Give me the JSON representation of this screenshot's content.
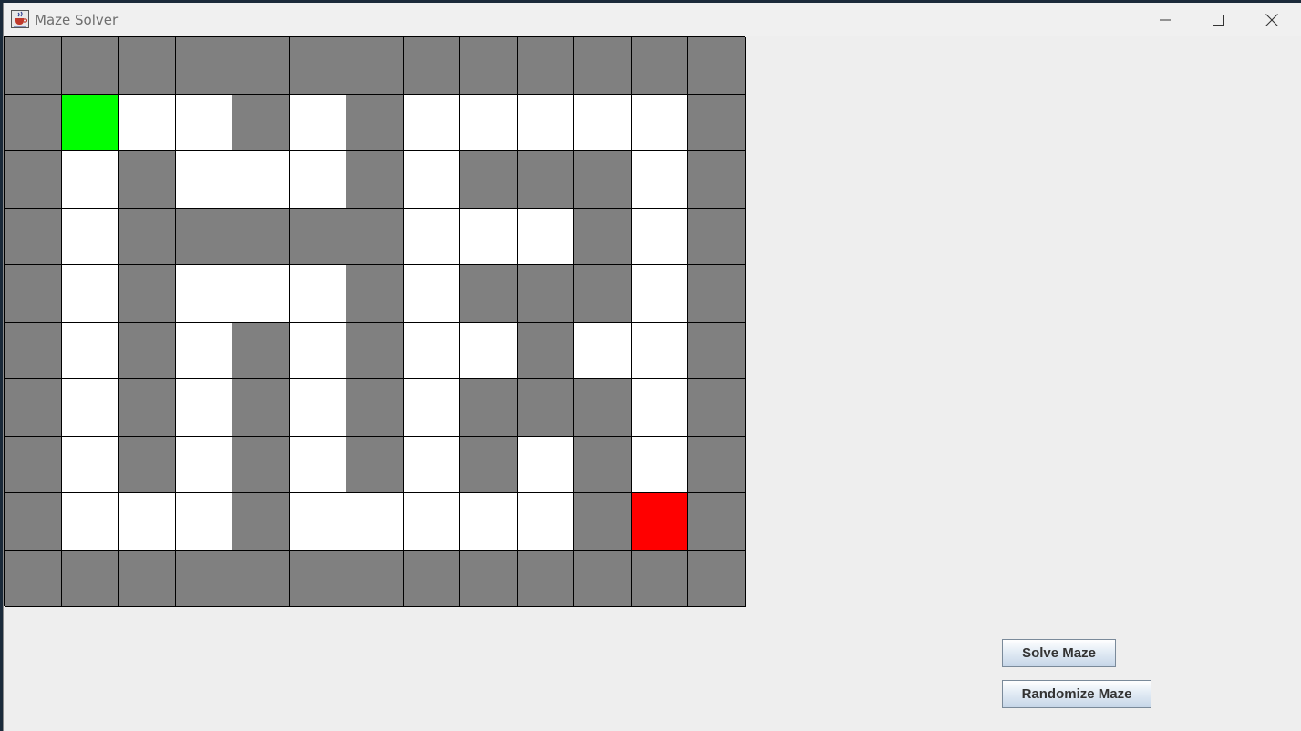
{
  "window": {
    "title": "Maze Solver",
    "icon": "java-cup-icon",
    "controls": [
      "minimize-icon",
      "maximize-icon",
      "close-icon"
    ]
  },
  "maze": {
    "rows": 10,
    "cols": 13,
    "legend": {
      "W": "wall",
      "O": "open",
      "S": "start",
      "E": "end"
    },
    "colors": {
      "wall": "#808080",
      "open": "#ffffff",
      "start": "#00ff00",
      "end": "#ff0000"
    },
    "grid": [
      "WWWWWWWWWWWWW",
      "WSOOWOWOOOOOW",
      "WOWOOOWOWWWOW",
      "WOWWWWWOOOWOW",
      "WOWOOOWOWWWOW",
      "WOWOWOWOOWOOW",
      "WOWOWOWOWWWOW",
      "WOWOWOWOWOWOW",
      "WOOOWOOOOOWEW",
      "WWWWWWWWWWWWW"
    ]
  },
  "buttons": {
    "solve_label": "Solve Maze",
    "randomize_label": "Randomize Maze"
  }
}
